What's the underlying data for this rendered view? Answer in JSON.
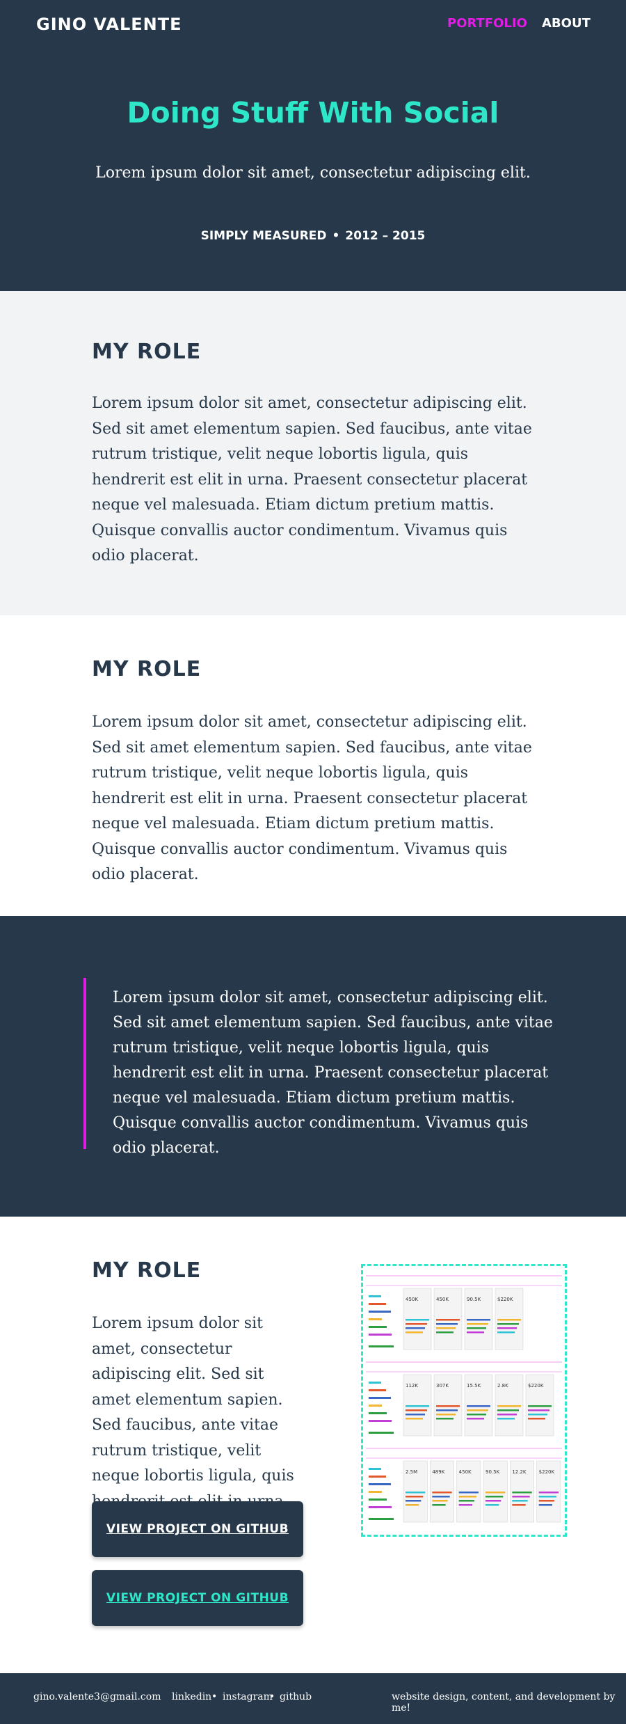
{
  "nav": {
    "brand": "GINO VALENTE",
    "portfolio": "PORTFOLIO",
    "about": "ABOUT"
  },
  "hero": {
    "title": "Doing Stuff With Social",
    "subtitle": "Lorem ipsum dolor sit amet, consectetur adipiscing elit.",
    "company": "SIMPLY MEASURED",
    "separator": "•",
    "years": "2012 – 2015"
  },
  "section1": {
    "heading": "MY ROLE",
    "body": "Lorem ipsum dolor sit amet, consectetur adipiscing elit. Sed sit amet elementum sapien. Sed faucibus, ante vitae rutrum tristique, velit neque lobortis ligula, quis hendrerit est elit in urna. Praesent consectetur placerat neque vel malesuada. Etiam dictum pretium mattis. Quisque convallis auctor condimentum. Vivamus quis odio placerat."
  },
  "section2": {
    "heading": "MY ROLE",
    "body": "Lorem ipsum dolor sit amet, consectetur adipiscing elit. Sed sit amet elementum sapien. Sed faucibus, ante vitae rutrum tristique, velit neque lobortis ligula, quis hendrerit est elit in urna. Praesent consectetur placerat neque vel malesuada. Etiam dictum pretium mattis. Quisque convallis auctor condimentum. Vivamus quis odio placerat."
  },
  "quote": {
    "text": "Lorem ipsum dolor sit amet, consectetur adipiscing elit. Sed sit amet elementum sapien. Sed faucibus, ante vitae rutrum tristique, velit neque lobortis ligula, quis hendrerit est elit in urna. Praesent consectetur placerat neque vel malesuada. Etiam dictum pretium mattis. Quisque convallis auctor condimentum. Vivamus quis odio placerat."
  },
  "project": {
    "heading": "MY ROLE",
    "body": "Lorem ipsum dolor sit amet, consectetur adipiscing elit. Sed sit amet elementum sapien. Sed faucibus, ante vitae rutrum tristique, velit neque lobortis ligula, quis hendrerit est elit in urna.",
    "button_primary": "VIEW PROJECT ON GITHUB",
    "button_secondary": "VIEW PROJECT ON GITHUB",
    "mockup_rows": [
      {
        "stats": [
          "450K",
          "450K",
          "90.5K",
          "$220K"
        ]
      },
      {
        "stats": [
          "112K",
          "307K",
          "15.5K",
          "2.8K",
          "$220K"
        ]
      },
      {
        "stats": [
          "2.5M",
          "489K",
          "450K",
          "90.5K",
          "12.2K",
          "$220K"
        ]
      }
    ]
  },
  "footer": {
    "email": "gino.valente3@gmail.com",
    "linkedin": "linkedin",
    "instagram": "instagram",
    "github": "github",
    "dot": "•",
    "credit": "website design, content, and development by me!"
  },
  "colors": {
    "navy": "#263849",
    "teal": "#2ee6c8",
    "magenta": "#e11de5",
    "light_grey": "#f2f3f5"
  }
}
